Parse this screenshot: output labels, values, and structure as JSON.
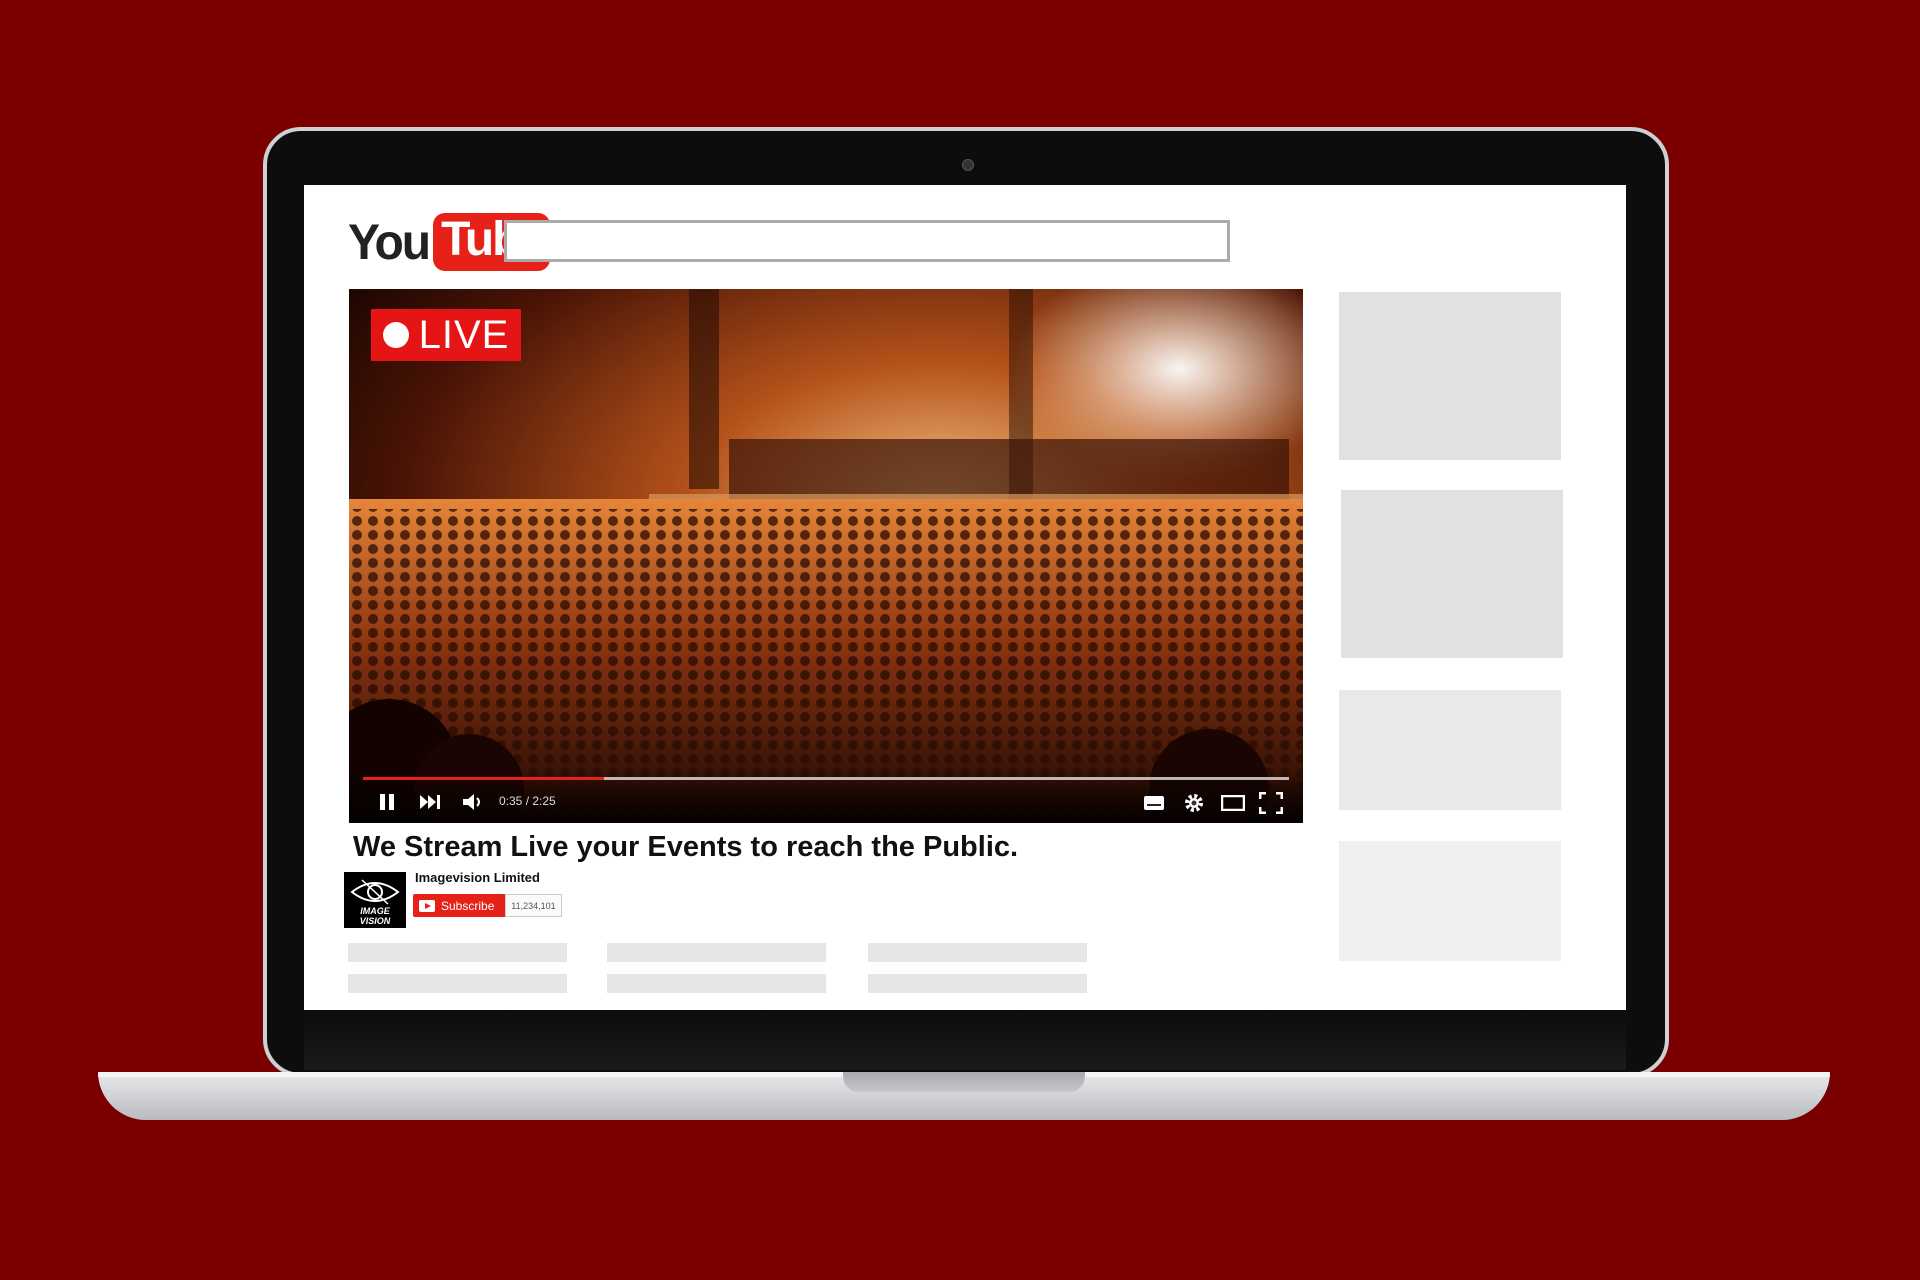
{
  "colors": {
    "background": "#7a0000",
    "accent": "#e62117",
    "screen": "#ffffff",
    "placeholder": "#e3e3e3"
  },
  "logo": {
    "you": "You",
    "tube": "Tube"
  },
  "search": {
    "value": ""
  },
  "player": {
    "live_label": "LIVE",
    "time_text": "0:35 / 2:25",
    "progress_fraction": 0.26,
    "controls": [
      "pause-icon",
      "next-icon",
      "volume-icon",
      "subtitles-icon",
      "settings-gear-icon",
      "theater-mode-icon",
      "fullscreen-icon"
    ]
  },
  "video": {
    "title": "We Stream Live your Events to reach the Public."
  },
  "channel": {
    "name": "Imagevision Limited",
    "avatar_text": "IMAGE VISION",
    "subscribe_label": "Subscribe",
    "subscriber_count": "11,234,101"
  }
}
